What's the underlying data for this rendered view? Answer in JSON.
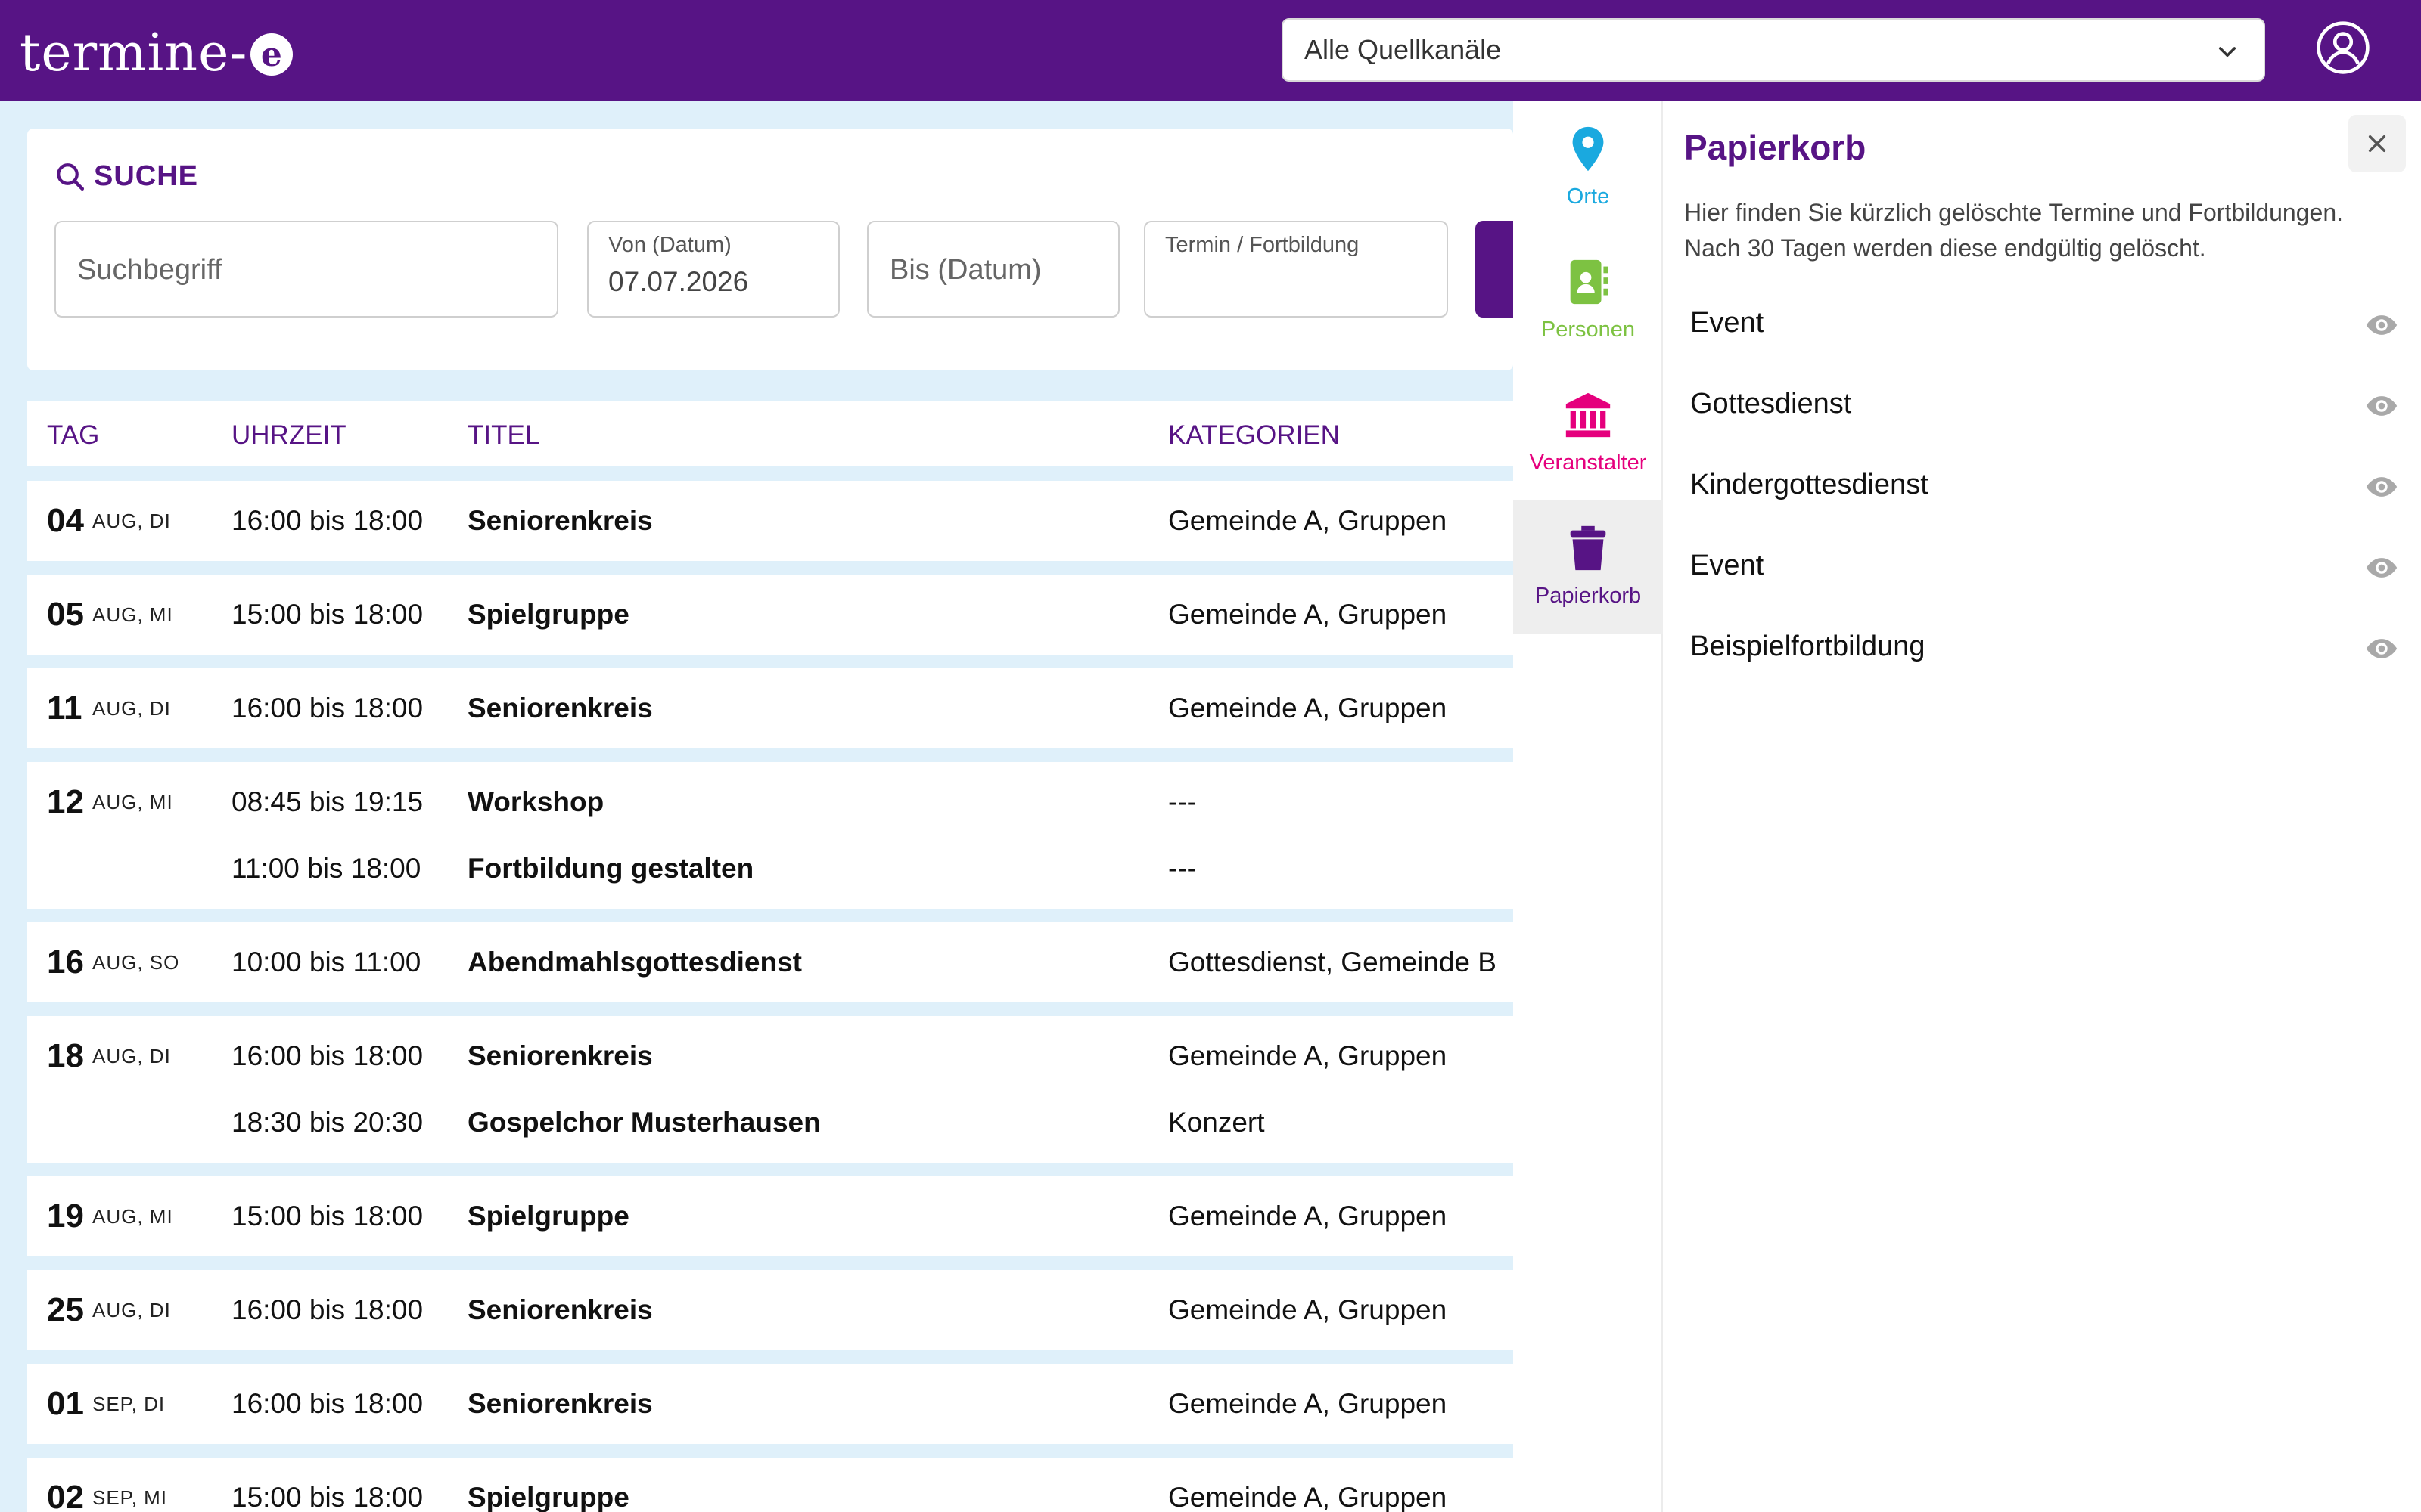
{
  "header": {
    "logo_text": "termine-",
    "logo_badge": "e",
    "source_select": "Alle Quellkanäle"
  },
  "search": {
    "title": "SUCHE",
    "keyword_placeholder": "Suchbegriff",
    "from_label": "Von (Datum)",
    "from_value": "07.07.2026",
    "to_placeholder": "Bis (Datum)",
    "type_label": "Termin / Fortbildung"
  },
  "table": {
    "columns": {
      "day": "TAG",
      "time": "UHRZEIT",
      "title": "TITEL",
      "categories": "KATEGORIEN"
    },
    "groups": [
      {
        "day": "04",
        "dow": "AUG, DI",
        "events": [
          {
            "time": "16:00 bis 18:00",
            "title": "Seniorenkreis",
            "categories": "Gemeinde A, Gruppen"
          }
        ]
      },
      {
        "day": "05",
        "dow": "AUG, MI",
        "events": [
          {
            "time": "15:00 bis 18:00",
            "title": "Spielgruppe",
            "categories": "Gemeinde A, Gruppen"
          }
        ]
      },
      {
        "day": "11",
        "dow": "AUG, DI",
        "events": [
          {
            "time": "16:00 bis 18:00",
            "title": "Seniorenkreis",
            "categories": "Gemeinde A, Gruppen"
          }
        ]
      },
      {
        "day": "12",
        "dow": "AUG, MI",
        "events": [
          {
            "time": "08:45 bis 19:15",
            "title": "Workshop",
            "categories": "---"
          },
          {
            "time": "11:00 bis 18:00",
            "title": "Fortbildung gestalten",
            "categories": "---"
          }
        ]
      },
      {
        "day": "16",
        "dow": "AUG, SO",
        "events": [
          {
            "time": "10:00 bis 11:00",
            "title": "Abendmahlsgottesdienst",
            "categories": "Gottesdienst, Gemeinde B"
          }
        ]
      },
      {
        "day": "18",
        "dow": "AUG, DI",
        "events": [
          {
            "time": "16:00 bis 18:00",
            "title": "Seniorenkreis",
            "categories": "Gemeinde A, Gruppen"
          },
          {
            "time": "18:30 bis 20:30",
            "title": "Gospelchor Musterhausen",
            "categories": "Konzert"
          }
        ]
      },
      {
        "day": "19",
        "dow": "AUG, MI",
        "events": [
          {
            "time": "15:00 bis 18:00",
            "title": "Spielgruppe",
            "categories": "Gemeinde A, Gruppen"
          }
        ]
      },
      {
        "day": "25",
        "dow": "AUG, DI",
        "events": [
          {
            "time": "16:00 bis 18:00",
            "title": "Seniorenkreis",
            "categories": "Gemeinde A, Gruppen"
          }
        ]
      },
      {
        "day": "01",
        "dow": "SEP, DI",
        "events": [
          {
            "time": "16:00 bis 18:00",
            "title": "Seniorenkreis",
            "categories": "Gemeinde A, Gruppen"
          }
        ]
      },
      {
        "day": "02",
        "dow": "SEP, MI",
        "events": [
          {
            "time": "15:00 bis 18:00",
            "title": "Spielgruppe",
            "categories": "Gemeinde A, Gruppen"
          }
        ]
      }
    ]
  },
  "side_nav": {
    "items": [
      {
        "label": "Orte",
        "icon": "location-pin-icon",
        "color": "#1aa9df"
      },
      {
        "label": "Personen",
        "icon": "contact-book-icon",
        "color": "#7dc242"
      },
      {
        "label": "Veranstalter",
        "icon": "institution-icon",
        "color": "#e5007d"
      },
      {
        "label": "Papierkorb",
        "icon": "trash-icon",
        "color": "#571485",
        "active": true
      }
    ]
  },
  "trash_panel": {
    "title": "Papierkorb",
    "description": "Hier finden Sie kürzlich gelöschte Termine und Fortbildungen. Nach 30 Tagen werden diese endgültig gelöscht.",
    "items": [
      {
        "name": "Event"
      },
      {
        "name": "Gottesdienst"
      },
      {
        "name": "Kindergottesdienst"
      },
      {
        "name": "Event"
      },
      {
        "name": "Beispielfortbildung"
      }
    ]
  },
  "colors": {
    "brand": "#571485",
    "background": "#dff0fa"
  }
}
